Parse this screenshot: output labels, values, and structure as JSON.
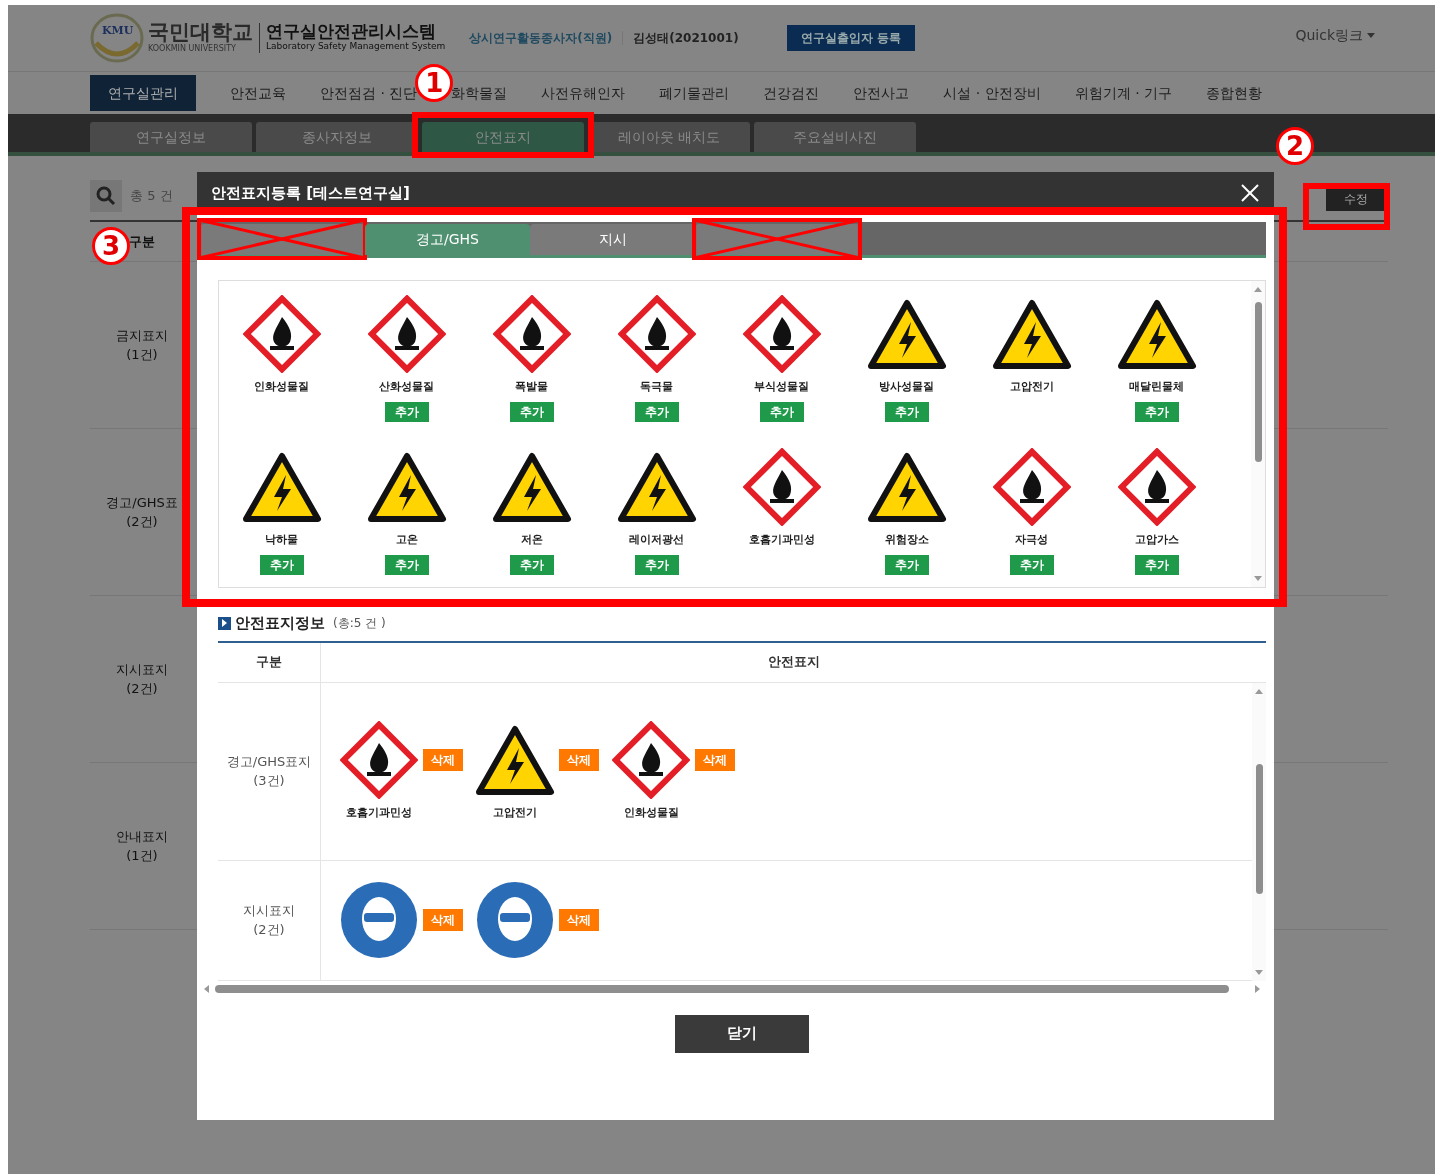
{
  "header": {
    "logo_mark": "KMU",
    "university": "국민대학교",
    "university_en": "KOOKMIN UNIVERSITY",
    "system": "연구실안전관리시스템",
    "system_en": "Laboratory Safety Management System",
    "user_role": "상시연구활동종사자(직원)",
    "user_name": "김성태(2021001)",
    "register_button": "연구실출입자 등록",
    "quick_link": "Quick링크"
  },
  "menu": [
    {
      "label": "연구실관리",
      "selected": true
    },
    {
      "label": "안전교육",
      "selected": false
    },
    {
      "label": "안전점검 · 진단",
      "selected": false
    },
    {
      "label": "화학물질",
      "selected": false
    },
    {
      "label": "사전유해인자",
      "selected": false
    },
    {
      "label": "폐기물관리",
      "selected": false
    },
    {
      "label": "건강검진",
      "selected": false
    },
    {
      "label": "안전사고",
      "selected": false
    },
    {
      "label": "시설 · 안전장비",
      "selected": false
    },
    {
      "label": "위험기계 · 기구",
      "selected": false
    },
    {
      "label": "종합현황",
      "selected": false
    }
  ],
  "subtabs": [
    {
      "label": "연구실정보",
      "selected": false
    },
    {
      "label": "종사자정보",
      "selected": false
    },
    {
      "label": "안전표지",
      "selected": true
    },
    {
      "label": "레이아웃 배치도",
      "selected": false
    },
    {
      "label": "주요설비사진",
      "selected": false
    }
  ],
  "lab_list": {
    "total": "총 5 건",
    "column": "구분",
    "rows": [
      {
        "label": "금지표지",
        "count": "(1건)"
      },
      {
        "label": "경고/GHS표",
        "count": "(2건)"
      },
      {
        "label": "지시표지",
        "count": "(2건)"
      },
      {
        "label": "안내표지",
        "count": "(1건)"
      }
    ]
  },
  "edit_button": "수정",
  "dialog": {
    "title": "안전표지등록 [테스트연구실]",
    "tabs": [
      {
        "selected": false,
        "crossed_out": true
      },
      {
        "label": "경고/GHS",
        "selected": true,
        "crossed_out": false
      },
      {
        "label": "지시",
        "selected": false,
        "crossed_out": false
      },
      {
        "selected": false,
        "crossed_out": true
      }
    ],
    "signs": [
      {
        "label": "인화성물질",
        "kind": "diamond"
      },
      {
        "label": "산화성물질",
        "kind": "diamond",
        "button": "추가"
      },
      {
        "label": "폭발물",
        "kind": "diamond",
        "button": "추가"
      },
      {
        "label": "독극물",
        "kind": "diamond",
        "button": "추가"
      },
      {
        "label": "부식성물질",
        "kind": "diamond",
        "button": "추가"
      },
      {
        "label": "방사성물질",
        "kind": "triangle",
        "button": "추가"
      },
      {
        "label": "고압전기",
        "kind": "triangle"
      },
      {
        "label": "매달린물체",
        "kind": "triangle",
        "button": "추가"
      },
      {
        "label": "낙하물",
        "kind": "triangle",
        "button": "추가"
      },
      {
        "label": "고온",
        "kind": "triangle",
        "button": "추가"
      },
      {
        "label": "저온",
        "kind": "triangle",
        "button": "추가"
      },
      {
        "label": "레이저광선",
        "kind": "triangle",
        "button": "추가"
      },
      {
        "label": "호흡기과민성",
        "kind": "diamond"
      },
      {
        "label": "위험장소",
        "kind": "triangle",
        "button": "추가"
      },
      {
        "label": "자극성",
        "kind": "diamond",
        "button": "추가"
      },
      {
        "label": "고압가스",
        "kind": "diamond",
        "button": "추가"
      }
    ],
    "info": {
      "title": "안전표지정보",
      "count": "(총:5 건 )",
      "columns": [
        "구분",
        "안전표지"
      ],
      "rows": [
        {
          "category": "경고/GHS표지",
          "count": "(3건)",
          "signs": [
            {
              "kind": "diamond",
              "label": "호흡기과민성",
              "button": "삭제"
            },
            {
              "kind": "triangle",
              "label": "고압전기",
              "button": "삭제"
            },
            {
              "kind": "diamond",
              "label": "인화성물질",
              "button": "삭제"
            }
          ]
        },
        {
          "category": "지시표지",
          "count": "(2건)",
          "signs": [
            {
              "kind": "circle",
              "button": "삭제"
            },
            {
              "kind": "circle",
              "button": "삭제"
            }
          ]
        }
      ]
    },
    "close_button": "닫기"
  },
  "callouts": [
    {
      "label": "1"
    },
    {
      "label": "2"
    },
    {
      "label": "3"
    }
  ]
}
